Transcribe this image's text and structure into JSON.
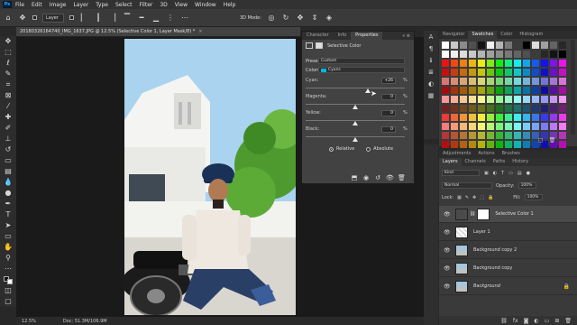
{
  "app": {
    "logo": "Ps"
  },
  "menu": [
    "File",
    "Edit",
    "Image",
    "Layer",
    "Type",
    "Select",
    "Filter",
    "3D",
    "View",
    "Window",
    "Help"
  ],
  "options": {
    "auto_select_target": "Layer",
    "show_transform": "",
    "mode_label": "3D Mode:"
  },
  "document": {
    "tab_title": "20180326164740_IMG_1637.JPG @ 12.5% (Selective Color 1, Layer Mask/8) *",
    "close": "×"
  },
  "status": {
    "zoom": "12.5%",
    "doc": "Doc: 51.3M/106.9M"
  },
  "properties": {
    "tabs": [
      "Character",
      "Info",
      "Properties"
    ],
    "active_tab": "Properties",
    "title": "Selective Color",
    "preset_label": "Preset:",
    "preset_value": "Custom",
    "colors_label": "Colors:",
    "colors_value": "Cyans",
    "sliders": [
      {
        "label": "Cyan:",
        "value": "+26",
        "unit": "%",
        "position": 0.63
      },
      {
        "label": "Magenta:",
        "value": "0",
        "unit": "%",
        "position": 0.5
      },
      {
        "label": "Yellow:",
        "value": "0",
        "unit": "%",
        "position": 0.5
      },
      {
        "label": "Black:",
        "value": "0",
        "unit": "%",
        "position": 0.5
      }
    ],
    "method_relative": "Relative",
    "method_absolute": "Absolute",
    "method_selected": "Relative"
  },
  "swatches": {
    "tabs": [
      "Navigator",
      "Swatches",
      "Color",
      "Histogram"
    ],
    "active_tab": "Swatches"
  },
  "layers": {
    "tabs": [
      "Adjustments",
      "Actions",
      "Brushes"
    ],
    "subtabs": [
      "Layers",
      "Channels",
      "Paths",
      "History"
    ],
    "filter_label": "Kind",
    "blend_mode": "Normal",
    "opacity_label": "Opacity:",
    "opacity_value": "100%",
    "lock_label": "Lock:",
    "fill_label": "Fill:",
    "fill_value": "100%",
    "items": [
      {
        "name": "Selective Color 1",
        "selected": true
      },
      {
        "name": "Layer 1",
        "selected": false
      },
      {
        "name": "Background copy 2",
        "selected": false
      },
      {
        "name": "Background copy",
        "selected": false
      },
      {
        "name": "Background",
        "selected": false
      }
    ]
  }
}
